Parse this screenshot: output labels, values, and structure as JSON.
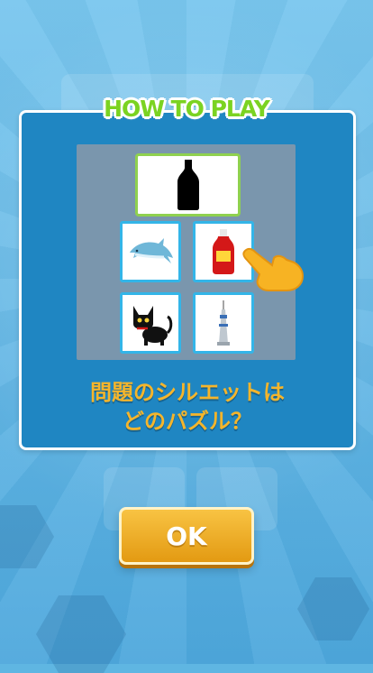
{
  "dialog": {
    "title": "HOW TO PLAY",
    "question_line1": "問題のシルエットは",
    "question_line2": "どのパズル？",
    "ok_label": "OK"
  },
  "demo": {
    "target_icon": "bottle-silhouette-icon",
    "choices": [
      "dolphin-icon",
      "ketchup-bottle-icon",
      "black-cat-icon",
      "tower-icon"
    ]
  },
  "colors": {
    "title_green": "#7bd321",
    "panel_blue": "#1f86c2",
    "question_orange": "#f5b52b",
    "ok_button": "#f0ad24"
  }
}
